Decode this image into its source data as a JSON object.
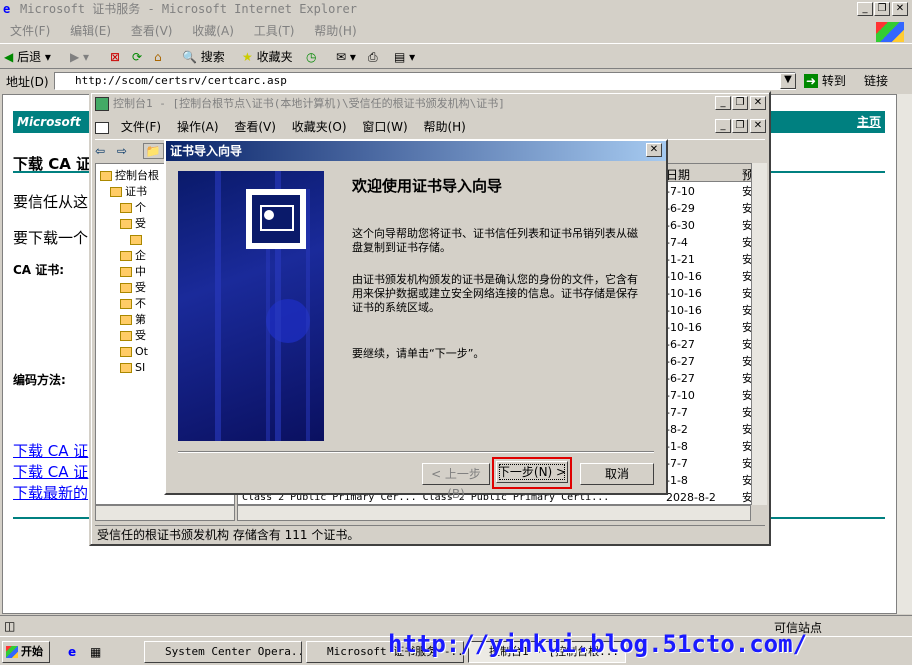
{
  "ie": {
    "title": "Microsoft 证书服务 - Microsoft Internet Explorer",
    "menu": [
      "文件(F)",
      "编辑(E)",
      "查看(V)",
      "收藏(A)",
      "工具(T)",
      "帮助(H)"
    ],
    "toolbar": {
      "back": "后退",
      "search": "搜索",
      "favorites": "收藏夹"
    },
    "address_label": "地址(D)",
    "address_value": "http://scom/certsrv/certcarc.asp",
    "go": "转到",
    "links": "链接"
  },
  "page": {
    "banner_title": "Microsoft",
    "home_link": "主页",
    "heading": "下载 CA 证",
    "p1": "要信任从这",
    "p2": "要下载一个",
    "ca_label": "CA 证书:",
    "encode_label": "编码方法:",
    "link1": "下载 CA 证",
    "link2": "下载 CA 证",
    "link3": "下载最新的"
  },
  "mmc": {
    "title": "控制台1 - [控制台根节点\\证书(本地计算机)\\受信任的根证书颁发机构\\证书]",
    "menu": [
      "文件(F)",
      "操作(A)",
      "查看(V)",
      "收藏夹(O)",
      "窗口(W)",
      "帮助(H)"
    ],
    "tree": [
      {
        "label": "控制台根",
        "indent": 0
      },
      {
        "label": "证书",
        "indent": 1
      },
      {
        "label": "个",
        "indent": 2
      },
      {
        "label": "受",
        "indent": 2
      },
      {
        "label": "",
        "indent": 3
      },
      {
        "label": "企",
        "indent": 2
      },
      {
        "label": "中",
        "indent": 2
      },
      {
        "label": "受",
        "indent": 2
      },
      {
        "label": "不",
        "indent": 2
      },
      {
        "label": "第",
        "indent": 2
      },
      {
        "label": "受",
        "indent": 2
      },
      {
        "label": "Ot",
        "indent": 2
      },
      {
        "label": "SI",
        "indent": 2
      }
    ],
    "col_date": "日期",
    "col_purpose": "预",
    "dates": [
      "-7-10",
      "-6-29",
      "-6-30",
      "-7-4",
      "-1-21",
      "-10-16",
      "-10-16",
      "-10-16",
      "-10-16",
      "-6-27",
      "-6-27",
      "-6-27",
      "-7-10",
      "-7-7",
      "-8-2",
      "-1-8",
      "-7-7",
      "-1-8",
      "2028-8-2"
    ],
    "purpose": "安",
    "last_row_text": "Class 2 Public Primary Cer...    Class 2 Public Primary Certi...",
    "status": "受信任的根证书颁发机构 存储含有 111 个证书。"
  },
  "wizard": {
    "title": "证书导入向导",
    "heading": "欢迎使用证书导入向导",
    "para1": "这个向导帮助您将证书、证书信任列表和证书吊销列表从磁盘复制到证书存储。",
    "para2": "由证书颁发机构颁发的证书是确认您的身份的文件，它含有用来保护数据或建立安全网络连接的信息。证书存储是保存证书的系统区域。",
    "para3": "要继续，请单击“下一步”。",
    "back_btn": "< 上一步(B)",
    "next_btn": "下一步(N) >",
    "cancel_btn": "取消"
  },
  "taskbar": {
    "start": "开始",
    "tasks": [
      "System Center Opera...",
      "Microsoft 证书服务 -...",
      "控制台1 - [控制台根..."
    ],
    "trusted": "可信站点"
  },
  "watermark": "http://yinkui.blog.51cto.com/",
  "colors": {
    "dlg_title": "#0a246a",
    "banner": "#008080",
    "highlight": "#e00000"
  }
}
